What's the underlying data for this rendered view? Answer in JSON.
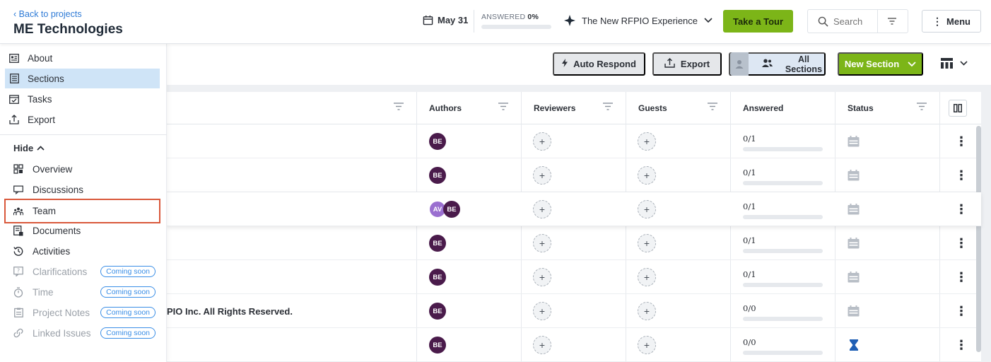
{
  "header": {
    "back_label": "Back to projects",
    "project_title": "ME Technologies",
    "due_date": "May 31",
    "answered_label": "ANSWERED",
    "answered_percent": "0%",
    "answered_progress": 0,
    "experience_label": "The New RFPIO Experience",
    "tour_button": "Take a Tour",
    "search_placeholder": "Search",
    "menu_button": "Menu"
  },
  "sidebar": {
    "items": [
      {
        "label": "About",
        "icon": "info-card-icon",
        "active": false
      },
      {
        "label": "Sections",
        "icon": "document-icon",
        "active": true
      },
      {
        "label": "Tasks",
        "icon": "calendar-check-icon",
        "active": false
      },
      {
        "label": "Export",
        "icon": "upload-icon",
        "active": false
      }
    ],
    "hide_label": "Hide",
    "more_items": [
      {
        "label": "Overview",
        "icon": "dashboard-icon",
        "disabled": false
      },
      {
        "label": "Discussions",
        "icon": "chat-icon",
        "disabled": false
      },
      {
        "label": "Team",
        "icon": "team-icon",
        "disabled": false,
        "highlighted": true
      },
      {
        "label": "Documents",
        "icon": "documents-icon",
        "disabled": false
      },
      {
        "label": "Activities",
        "icon": "history-icon",
        "disabled": false
      },
      {
        "label": "Clarifications",
        "icon": "question-icon",
        "disabled": true,
        "badge": "Coming soon"
      },
      {
        "label": "Time",
        "icon": "stopwatch-icon",
        "disabled": true,
        "badge": "Coming soon"
      },
      {
        "label": "Project Notes",
        "icon": "notes-icon",
        "disabled": true,
        "badge": "Coming soon"
      },
      {
        "label": "Linked Issues",
        "icon": "link-icon",
        "disabled": true,
        "badge": "Coming soon"
      }
    ]
  },
  "toolbar": {
    "auto_respond": "Auto Respond",
    "export": "Export",
    "all_sections": "All Sections",
    "new_section": "New Section"
  },
  "table": {
    "columns": [
      "Authors",
      "Reviewers",
      "Guests",
      "Answered",
      "Status"
    ],
    "rows": [
      {
        "text": "",
        "authors": [
          "BE"
        ],
        "answered": "0/1",
        "status": "calendar-icon"
      },
      {
        "text": "",
        "authors": [
          "BE"
        ],
        "answered": "0/1",
        "status": "calendar-icon"
      },
      {
        "text": "",
        "authors": [
          "AV",
          "BE"
        ],
        "answered": "0/1",
        "status": "calendar-icon"
      },
      {
        "text": "",
        "authors": [
          "BE"
        ],
        "answered": "0/1",
        "status": "calendar-icon"
      },
      {
        "text": "",
        "authors": [
          "BE"
        ],
        "answered": "0/1",
        "status": "calendar-icon"
      },
      {
        "text": "PIO Inc. All Rights Reserved.",
        "authors": [
          "BE"
        ],
        "answered": "0/0",
        "status": "calendar-icon"
      },
      {
        "text": "",
        "authors": [
          "BE"
        ],
        "answered": "0/0",
        "status": "hourglass-icon"
      }
    ]
  },
  "colors": {
    "accent_green": "#7cb518",
    "link_blue": "#2d7ad6",
    "avatar_purple": "#4a1b4b",
    "highlight_red": "#d9583b"
  }
}
